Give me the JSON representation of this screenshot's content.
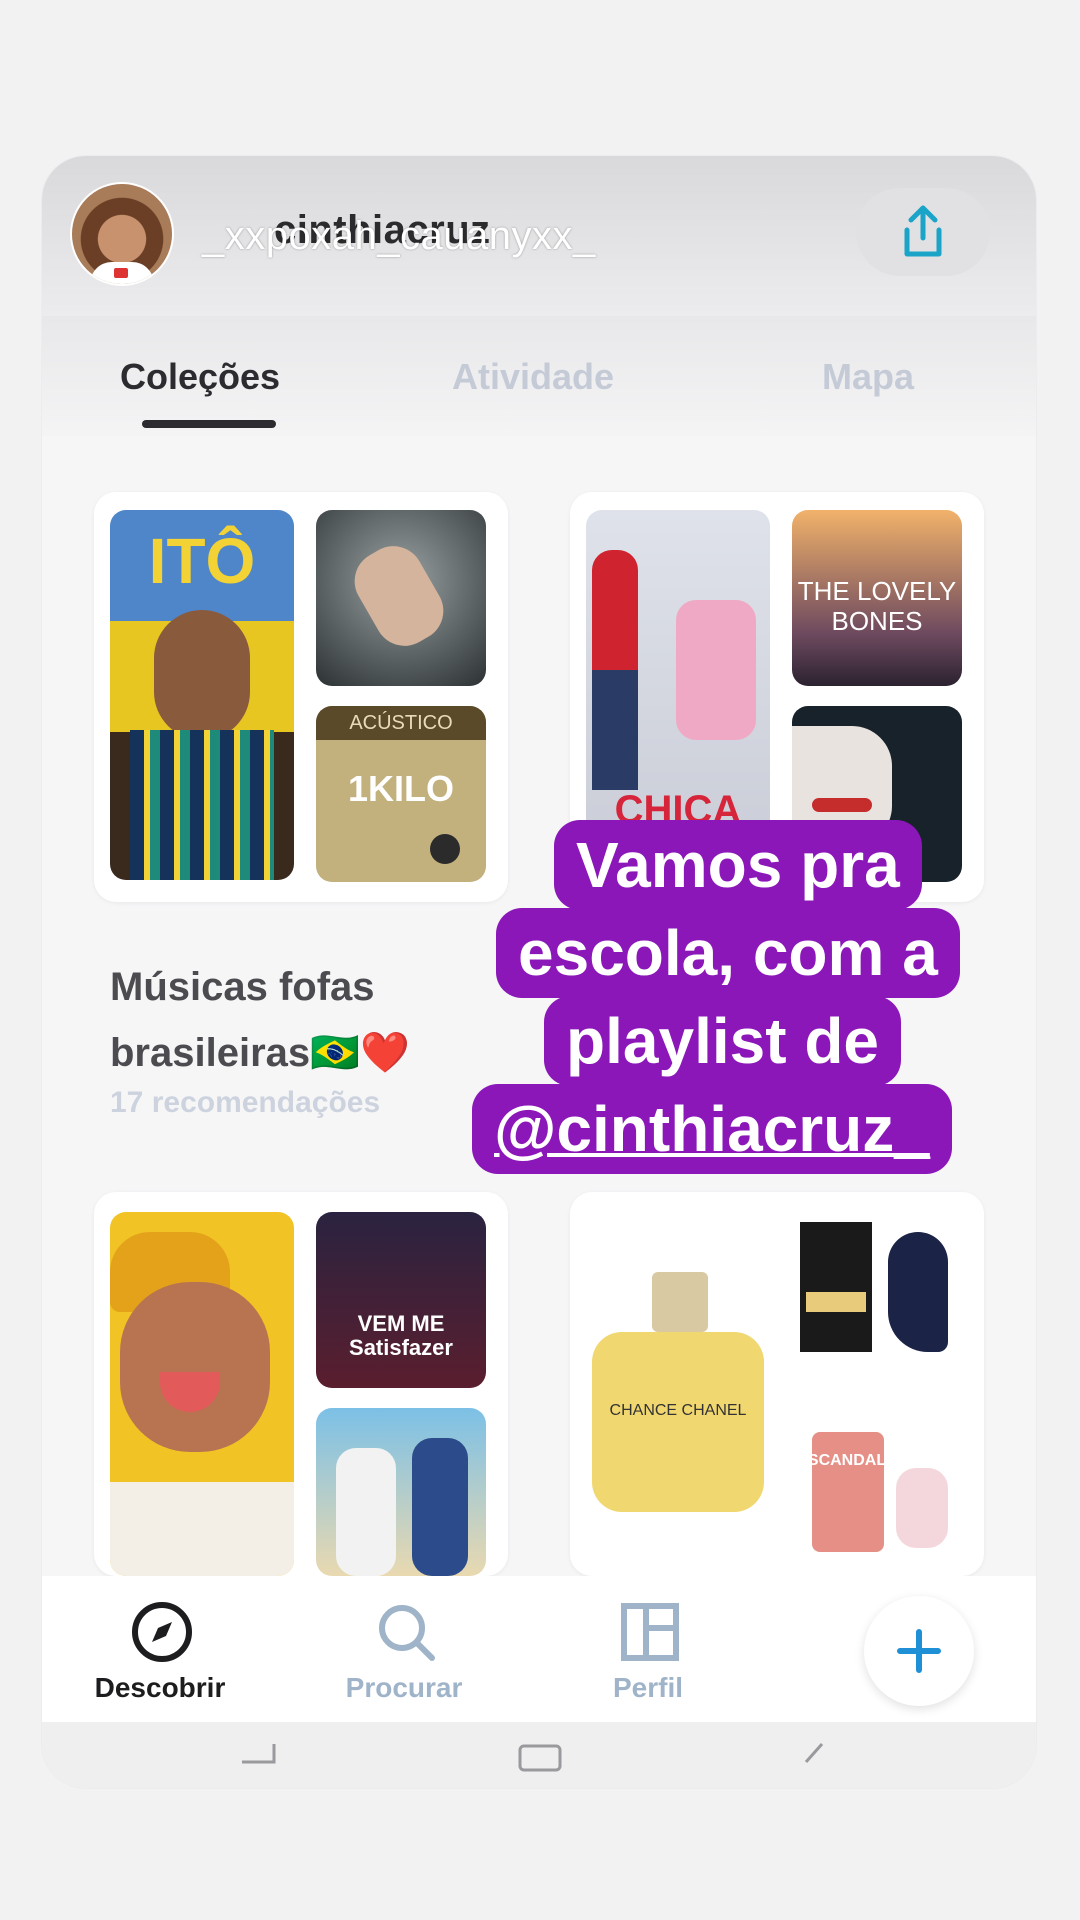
{
  "header": {
    "username_overlay": "_xxpoxah_cauanyxx_",
    "username_under": "cinthiacruz",
    "share_icon": "share-icon"
  },
  "tabs": [
    {
      "label": "Coleções",
      "active": true
    },
    {
      "label": "Atividade",
      "active": false
    },
    {
      "label": "Mapa",
      "active": false
    }
  ],
  "collections": [
    {
      "title": "Músicas fofas brasileiras🇧🇷❤️",
      "count": "17 recomendações",
      "art": [
        "ITÔ",
        "",
        "ACÚSTICO",
        "1KILO"
      ]
    },
    {
      "art": [
        "CHICA",
        "THE LOVELY BONES",
        ""
      ]
    },
    {
      "art": [
        "",
        "VEM ME Satisfazer",
        "",
        ""
      ]
    },
    {
      "art": [
        "CHANCE CHANEL",
        "",
        "",
        "SCANDAL"
      ]
    }
  ],
  "sticker": {
    "lines": [
      "Vamos pra",
      "escola, com a",
      "playlist de"
    ],
    "mention": "@cinthiacruz_",
    "color": "#8b17b8"
  },
  "bottom_nav": [
    {
      "label": "Descobrir",
      "icon": "compass-icon",
      "active": true
    },
    {
      "label": "Procurar",
      "icon": "search-icon",
      "active": false
    },
    {
      "label": "Perfil",
      "icon": "layout-icon",
      "active": false
    }
  ],
  "fab": {
    "icon": "plus-icon",
    "color": "#1f8fd6"
  }
}
